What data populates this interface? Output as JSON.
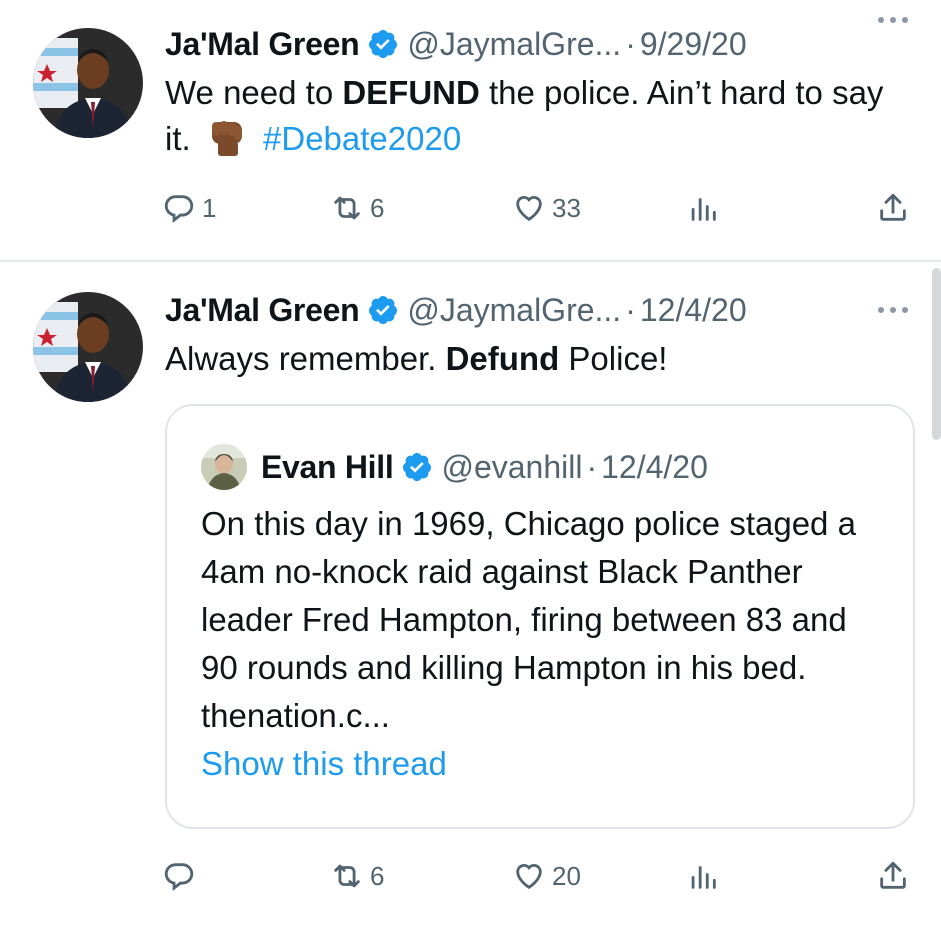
{
  "tweets": [
    {
      "author_name": "Ja'Mal Green",
      "handle": "@JaymalGre...",
      "separator": "·",
      "date": "9/29/20",
      "text_pre": "We need to ",
      "text_bold": "DEFUND",
      "text_post": " the police. Ain’t hard to say it.",
      "hashtag": "#Debate2020",
      "replies": "1",
      "retweets": "6",
      "likes": "33"
    },
    {
      "author_name": "Ja'Mal Green",
      "handle": "@JaymalGre...",
      "separator": "·",
      "date": "12/4/20",
      "text_pre": "Always remember. ",
      "text_bold": "Defund",
      "text_post": " Police!",
      "replies": "",
      "retweets": "6",
      "likes": "20",
      "quote": {
        "author_name": "Evan Hill",
        "handle": "@evanhill",
        "separator": "·",
        "date": "12/4/20",
        "text": "On this day in 1969, Chicago police staged a 4am no-knock raid against Black Panther leader Fred Hampton, firing between 83 and 90 rounds and killing Hampton in his bed. thenation.c...",
        "show_thread": "Show this thread"
      }
    }
  ],
  "colors": {
    "link": "#1d9bf0",
    "verified": "#1d9bf0",
    "muted": "#536471",
    "text": "#0f1419"
  },
  "icons": {
    "reply": "reply-icon",
    "retweet": "retweet-icon",
    "like": "heart-icon",
    "views": "views-icon",
    "share": "share-icon",
    "more": "more-icon",
    "verified": "verified-badge-icon",
    "emoji": "raised-fist-emoji"
  }
}
